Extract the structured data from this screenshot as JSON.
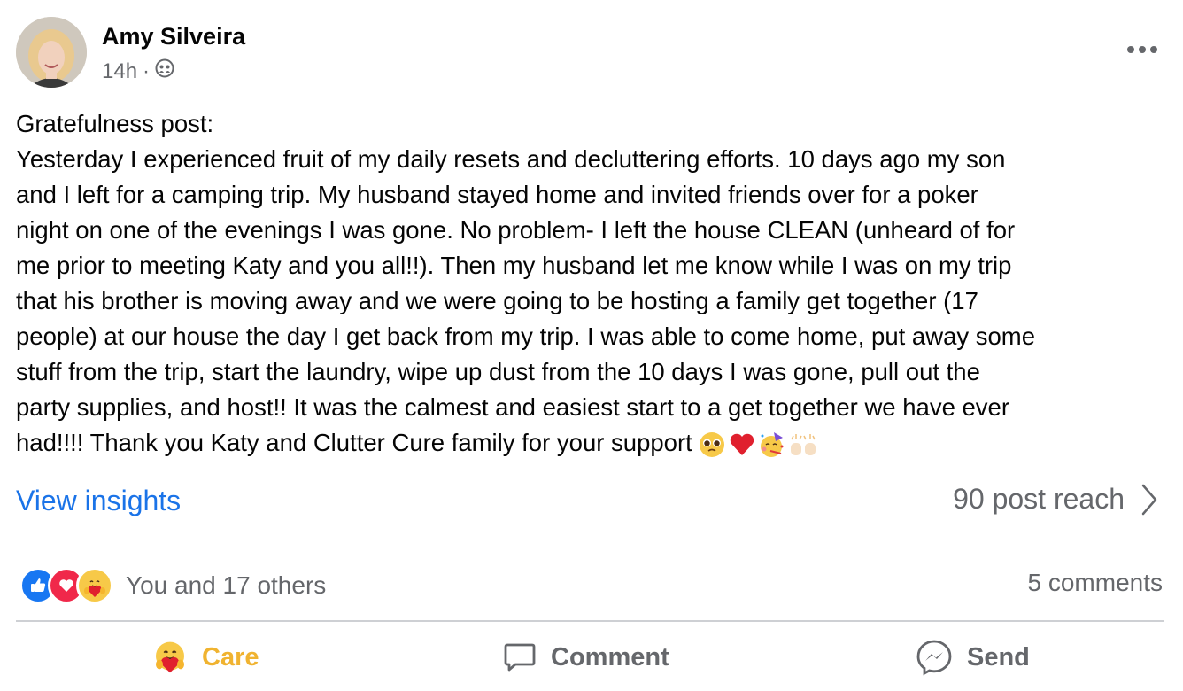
{
  "post": {
    "author": "Amy Silveira",
    "time": "14h",
    "audience_icon": "friends-icon",
    "lines": [
      "Gratefulness post:",
      "Yesterday I experienced fruit of my daily resets and decluttering efforts. 10 days ago my son",
      "and I left for a camping trip. My husband stayed home and invited friends over for a poker",
      "night on one of the evenings I was gone. No problem- I left the house CLEAN (unheard of for",
      "me prior to meeting Katy and you all!!). Then my husband let me know while I was on my trip",
      "that his brother is moving away and we were going to be hosting a family get together (17",
      "people) at our house the day I get back from my trip. I was able to come home, put away some",
      "stuff from the trip, start the laundry, wipe up dust from the 10 days I was gone, pull out the",
      "party supplies, and host!! It was the calmest and easiest start to a get together we have ever",
      "had!!!! Thank you Katy and Clutter Cure family for your support"
    ],
    "emojis": [
      "pleading-face-emoji",
      "red-heart-emoji",
      "partying-face-emoji",
      "raising-hands-emoji"
    ]
  },
  "insights": {
    "label": "View insights",
    "reach": "90 post reach"
  },
  "reactions": {
    "icons": [
      "like-icon",
      "love-icon",
      "care-icon"
    ],
    "summary": "You and 17 others",
    "comments": "5 comments"
  },
  "actions": {
    "care": "Care",
    "comment": "Comment",
    "send": "Send"
  },
  "colors": {
    "link": "#1a73e8",
    "care": "#f0b330",
    "muted": "#65676b"
  }
}
